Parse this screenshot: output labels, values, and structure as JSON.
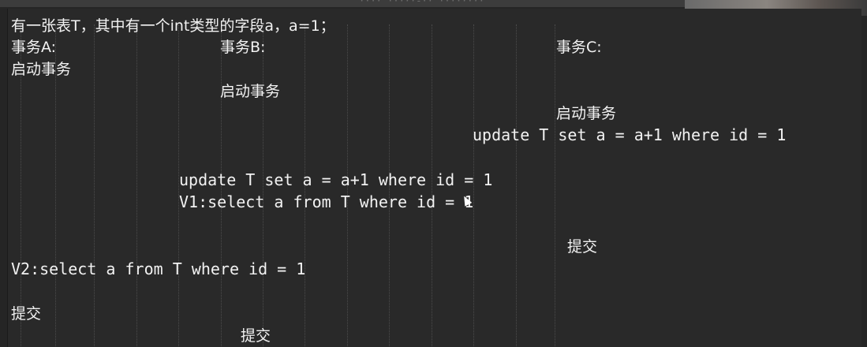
{
  "topbar": {
    "ghost_text": "···· ·····-·· ········"
  },
  "lines": {
    "intro": "有一张表T，其中有一个int类型的字段a，a=1；",
    "header_a": "事务A:",
    "header_b": "事务B:",
    "header_c": "事务C:",
    "a_start": "启动事务",
    "b_start": "启动事务",
    "c_start": "启动事务",
    "c_update": "update T set a = a+1 where id = 1",
    "b_update": "update T set a = a+1 where id = 1",
    "b_v1": "V1:select a from T where id = 1",
    "c_commit": "提交",
    "a_v2": "V2:select a from T where id = 1",
    "a_commit": "提交",
    "b_commit": "提交"
  }
}
